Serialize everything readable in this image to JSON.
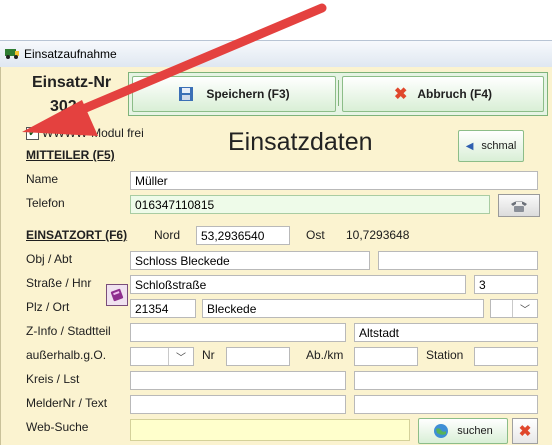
{
  "window": {
    "title": "Einsatzaufnahme"
  },
  "header": {
    "einsatz_nr_label": "Einsatz-Nr",
    "einsatz_nr_value": "302"
  },
  "toolbar": {
    "save_label": "Speichern (F3)",
    "cancel_label": "Abbruch (F4)"
  },
  "form": {
    "wwww_checkbox_label": "WWWW-Modul frei",
    "wwww_checked": true,
    "title": "Einsatzdaten",
    "schmal_label": "schmal",
    "mitteiler_header": "MITTEILER  (F5)",
    "name_label": "Name",
    "name_value": "Müller",
    "telefon_label": "Telefon",
    "telefon_value": "016347110815",
    "einsatzort_header": "EINSATZORT  (F6)",
    "nord_label": "Nord",
    "nord_value": "53,2936540",
    "ost_label": "Ost",
    "ost_value": "10,7293648",
    "obj_label": "Obj / Abt",
    "obj_value": "Schloss Bleckede",
    "obj_extra": "",
    "strasse_label": "Straße / Hnr",
    "strasse_value": "Schloßstraße",
    "hnr_value": "3",
    "plz_label": "Plz / Ort",
    "plz_value": "21354",
    "ort_value": "Bleckede",
    "ort_select": "",
    "zinfo_label": "Z-Info / Stadtteil",
    "zinfo_value": "",
    "stadtteil_value": "Altstadt",
    "ausserhalb_label": "außerhalb.g.O.",
    "ausserhalb_select": "",
    "nr_label": "Nr",
    "nr_value": "",
    "abkm_label": "Ab./km",
    "abkm_value": "",
    "station_label": "Station",
    "station_value": "",
    "kreis_label": "Kreis / Lst",
    "kreis_value": "",
    "lst_value": "",
    "melder_label": "MelderNr / Text",
    "melder_value": "",
    "melder_text_value": "",
    "websuche_label": "Web-Suche",
    "websuche_value": "",
    "suchen_label": "suchen"
  },
  "colors": {
    "panel_bg": "#fbf3d0",
    "arrow": "#e4413f",
    "green_field": "#eefbe9",
    "yellow_field": "#ffffcc"
  }
}
